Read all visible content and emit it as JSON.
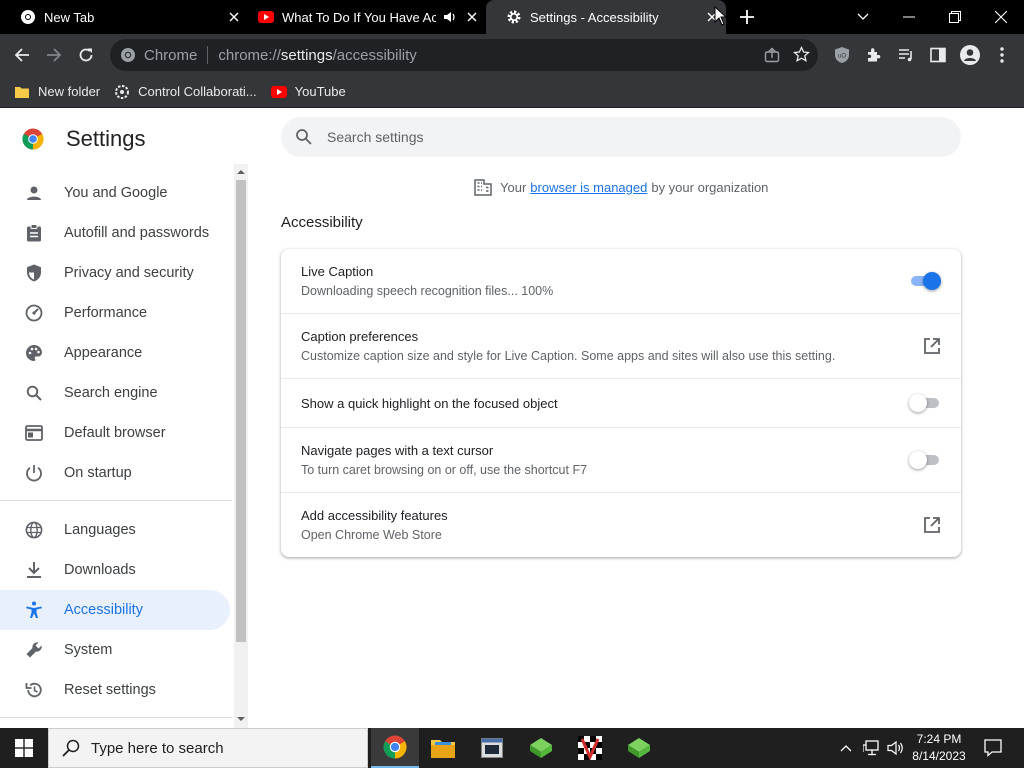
{
  "tabs": [
    {
      "title": "New Tab",
      "icon": "chrome-icon"
    },
    {
      "title": "What To Do If You Have Acci",
      "icon": "youtube-icon",
      "audible": true
    },
    {
      "title": "Settings - Accessibility",
      "icon": "gear-icon",
      "active": true
    }
  ],
  "omnibox": {
    "site_label": "Chrome",
    "url_prefix": "chrome://",
    "url_host": "settings",
    "url_path": "/accessibility"
  },
  "bookmarks": [
    {
      "label": "New folder",
      "icon": "folder-icon"
    },
    {
      "label": "Control Collaborati...",
      "icon": "control-icon"
    },
    {
      "label": "YouTube",
      "icon": "youtube-icon"
    }
  ],
  "settings": {
    "title": "Settings",
    "search_placeholder": "Search settings",
    "managed": {
      "before": "Your",
      "link": "browser is managed",
      "after": "by your organization"
    },
    "nav": [
      {
        "label": "You and Google",
        "icon": "person-icon"
      },
      {
        "label": "Autofill and passwords",
        "icon": "clipboard-icon"
      },
      {
        "label": "Privacy and security",
        "icon": "shield-icon"
      },
      {
        "label": "Performance",
        "icon": "speedometer-icon"
      },
      {
        "label": "Appearance",
        "icon": "palette-icon"
      },
      {
        "label": "Search engine",
        "icon": "search-icon"
      },
      {
        "label": "Default browser",
        "icon": "browser-icon"
      },
      {
        "label": "On startup",
        "icon": "power-icon"
      },
      {
        "label": "Languages",
        "icon": "globe-icon"
      },
      {
        "label": "Downloads",
        "icon": "download-icon"
      },
      {
        "label": "Accessibility",
        "icon": "accessibility-icon",
        "selected": true
      },
      {
        "label": "System",
        "icon": "wrench-icon"
      },
      {
        "label": "Reset settings",
        "icon": "reset-icon"
      }
    ],
    "section_title": "Accessibility",
    "rows": [
      {
        "title": "Live Caption",
        "subtitle": "Downloading speech recognition files... 100%",
        "control": "toggle",
        "on": true
      },
      {
        "title": "Caption preferences",
        "subtitle": "Customize caption size and style for Live Caption. Some apps and sites will also use this setting.",
        "control": "external-link"
      },
      {
        "title": "Show a quick highlight on the focused object",
        "subtitle": "",
        "control": "toggle",
        "on": false
      },
      {
        "title": "Navigate pages with a text cursor",
        "subtitle": "To turn caret browsing on or off, use the shortcut F7",
        "control": "toggle",
        "on": false
      },
      {
        "title": "Add accessibility features",
        "subtitle": "Open Chrome Web Store",
        "control": "external-link"
      }
    ]
  },
  "taskbar": {
    "search_placeholder": "Type here to search",
    "time": "7:24 PM",
    "date": "8/14/2023"
  },
  "colors": {
    "accent": "#1a73e8",
    "toolbar": "#35363a",
    "tabstrip": "#000000",
    "nav_selected_bg": "#e8f0fe"
  }
}
